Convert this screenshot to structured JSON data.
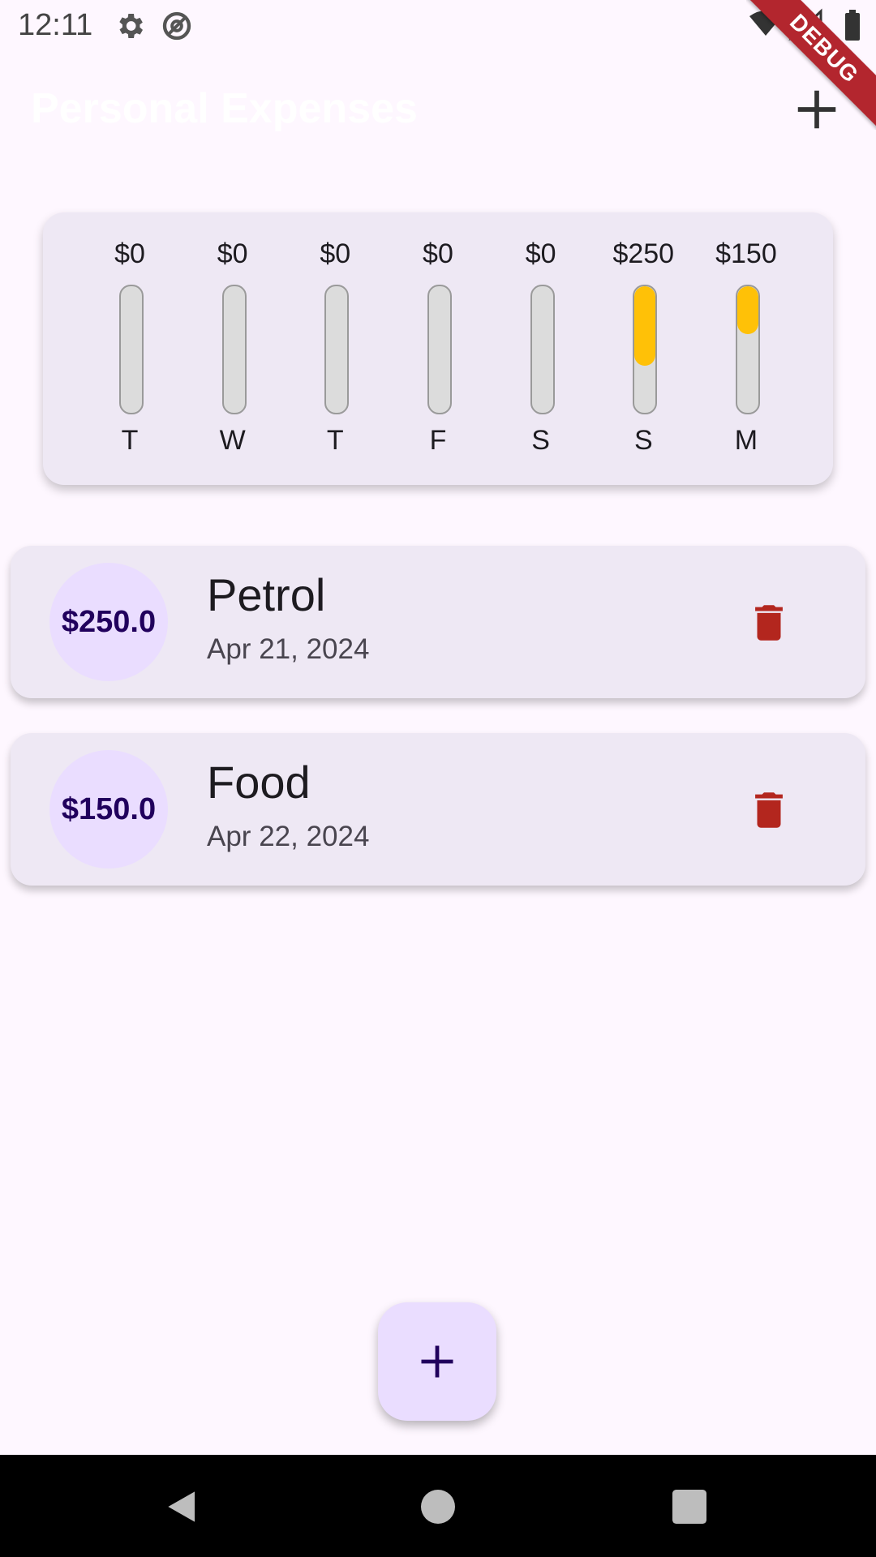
{
  "status_bar": {
    "time": "12:11",
    "icons": [
      "settings-icon",
      "vpn-icon",
      "wifi-icon",
      "signal-icon",
      "battery-icon"
    ]
  },
  "debug_banner": {
    "label": "DEBUG"
  },
  "app_bar": {
    "title": "Personal Expenses",
    "add_icon": "plus-icon"
  },
  "chart": {
    "bar_color": "#FFC107",
    "days": [
      {
        "day": "T",
        "amount": "$0",
        "fraction": 0
      },
      {
        "day": "W",
        "amount": "$0",
        "fraction": 0
      },
      {
        "day": "T",
        "amount": "$0",
        "fraction": 0
      },
      {
        "day": "F",
        "amount": "$0",
        "fraction": 0
      },
      {
        "day": "S",
        "amount": "$0",
        "fraction": 0
      },
      {
        "day": "S",
        "amount": "$250",
        "fraction": 0.625
      },
      {
        "day": "M",
        "amount": "$150",
        "fraction": 0.375
      }
    ]
  },
  "transactions": [
    {
      "amount": "$250.0",
      "title": "Petrol",
      "date": "Apr 21, 2024",
      "delete_icon": "trash-icon"
    },
    {
      "amount": "$150.0",
      "title": "Food",
      "date": "Apr 22, 2024",
      "delete_icon": "trash-icon"
    }
  ],
  "fab": {
    "icon": "plus-icon"
  },
  "nav_bar": {
    "icons": [
      "back-icon",
      "home-icon",
      "recents-icon"
    ]
  },
  "colors": {
    "background": "#FEF7FF",
    "card": "#EEE8F4",
    "avatar": "#EADDFF",
    "avatar_text": "#21005D",
    "delete": "#B3261E",
    "bar_fill": "#FFC107"
  }
}
